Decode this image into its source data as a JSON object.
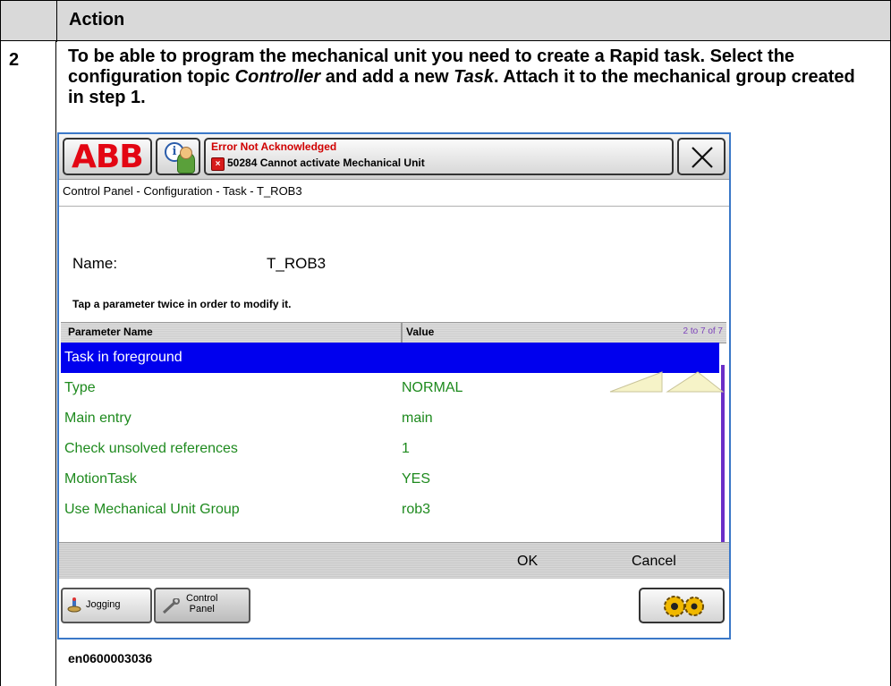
{
  "document": {
    "header_label": "Action",
    "step_number": "2",
    "step_text": {
      "part1": "To be able to program the mechanical unit you need to create a Rapid task. Select the configuration topic ",
      "controller": "Controller",
      "part2": " and add a new ",
      "task": "Task",
      "part3": ". Attach it to the mechanical group created in step 1."
    },
    "caption": "en0600003036"
  },
  "flexpendant": {
    "logo": "ABB",
    "status": {
      "title": "Error Not Acknowledged",
      "message": "50284 Cannot activate Mechanical Unit"
    },
    "breadcrumb": "Control Panel - Configuration - Task - T_ROB3",
    "name_label": "Name:",
    "name_value": "T_ROB3",
    "hint": "Tap a parameter twice in order to modify it.",
    "grid": {
      "col_param": "Parameter Name",
      "col_value": "Value",
      "count": "2 to 7 of 7",
      "rows": [
        {
          "param": "Task in foreground",
          "value": ""
        },
        {
          "param": "Type",
          "value": "NORMAL"
        },
        {
          "param": "Main entry",
          "value": "main"
        },
        {
          "param": "Check unsolved references",
          "value": "1"
        },
        {
          "param": "MotionTask",
          "value": "YES"
        },
        {
          "param": "Use Mechanical Unit Group",
          "value": "rob3"
        }
      ]
    },
    "ok_label": "OK",
    "cancel_label": "Cancel",
    "jogging_label": "Jogging",
    "control_panel_label_1": "Control",
    "control_panel_label_2": "Panel",
    "colors": {
      "selected_row": "#0000ee",
      "row_text": "#1e8a1e",
      "error_title": "#d00000",
      "abb_red": "#e30613"
    }
  }
}
